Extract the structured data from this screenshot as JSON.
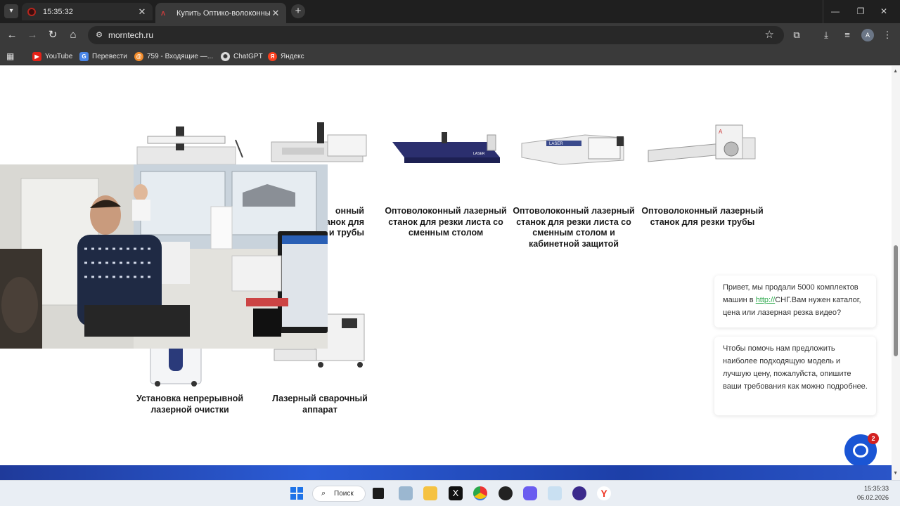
{
  "browser": {
    "tabs": [
      {
        "title": "15:35:32"
      },
      {
        "title": "Купить Оптико-волоконный л"
      }
    ],
    "url": "morntech.ru",
    "bookmarks": [
      {
        "label": "YouTube",
        "color": "#e62117"
      },
      {
        "label": "Перевести",
        "color": "#4a86e8"
      },
      {
        "label": "759 - Входящие —...",
        "color": "#f28b2a"
      },
      {
        "label": "ChatGPT",
        "color": "#9b9b9b"
      },
      {
        "label": "Яндекс",
        "color": "#fc3f1d"
      }
    ],
    "profile_initial": "A"
  },
  "products": [
    {
      "title": "Оптоволоконный лазерный станок для резки листа со сменным столом"
    },
    {
      "title": "Оптоволоконный лазерный станок для резки листа со сменным столом и кабинетной защитой"
    },
    {
      "title": "Оптоволоконный лазерный станок для резки трубы"
    },
    {
      "title": "Установка непрерывной лазерной очистки"
    },
    {
      "title": "Лазерный сварочный аппарат"
    }
  ],
  "partial_product": {
    "line1": "онный",
    "line2": "танок для",
    "line3": "и трубы"
  },
  "chat": {
    "message1_before": "Привет, мы продали 5000 комплектов машин в ",
    "message1_link": "http://",
    "message1_after": "СНГ.Вам нужен каталог, цена или лазерная резка видео?",
    "message2": "Чтобы помочь нам предложить наиболее подходящую модель и лучшую цену, пожалуйста, опишите ваши требования как можно подробнее.",
    "badge_count": "2"
  },
  "taskbar": {
    "search_label": "Поиск",
    "time": "15:35:33",
    "date": "06.02.2026"
  }
}
